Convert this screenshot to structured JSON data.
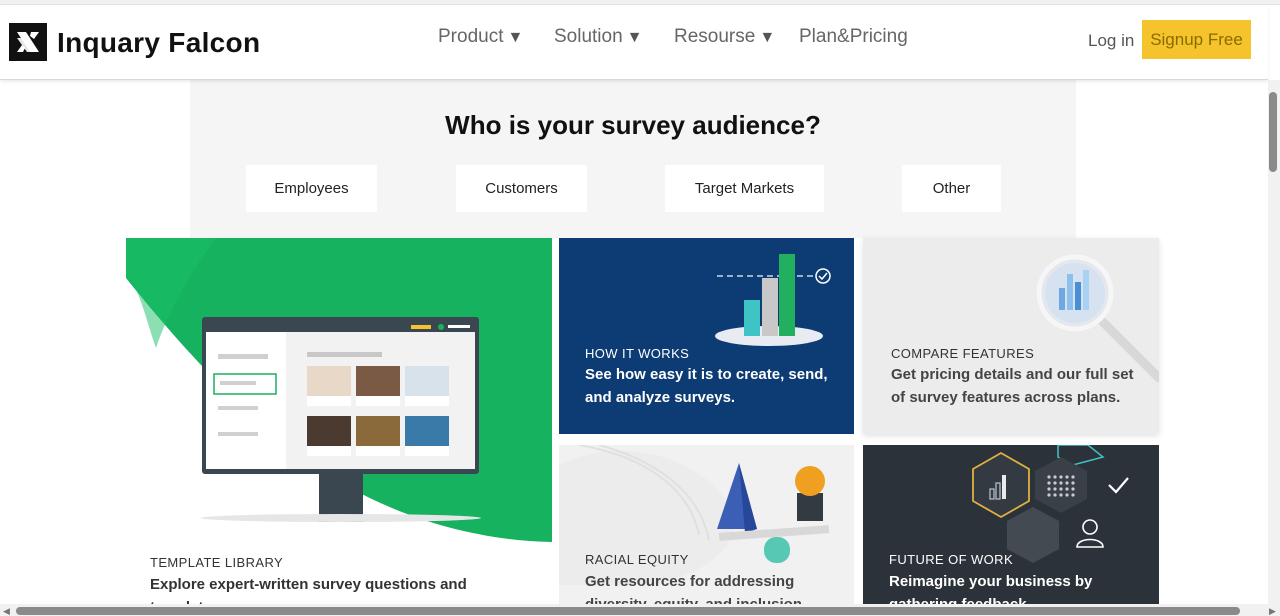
{
  "header": {
    "brand": "Inquary Falcon",
    "nav": [
      {
        "label": "Product",
        "caret": "▼"
      },
      {
        "label": "Solution",
        "caret": "▼"
      },
      {
        "label": "Resourse",
        "caret": "▼"
      },
      {
        "label": "Plan&Pricing",
        "caret": ""
      }
    ],
    "login": "Log in",
    "signup": "Signup Free"
  },
  "audience": {
    "title": "Who is your survey audience?",
    "options": [
      "Employees",
      "Customers",
      "Target Markets",
      "Other"
    ]
  },
  "cards": {
    "template_library": {
      "label": "TEMPLATE LIBRARY",
      "text": "Explore expert-written survey questions and templates"
    },
    "how_it_works": {
      "label": "HOW IT WORKS",
      "text_1": "See how easy it is to create, send,",
      "text_2": "and analyze surveys."
    },
    "compare_features": {
      "label": "COMPARE FEATURES",
      "text_1": "Get pricing details and our full set",
      "text_2": "of survey features across plans."
    },
    "racial_equity": {
      "label": "RACIAL EQUITY",
      "text_1": "Get resources for addressing",
      "text_2": "diversity, equity, and inclusion"
    },
    "future_of_work": {
      "label": "FUTURE OF WORK",
      "text_1": "Reimagine your business by",
      "text_2": "gathering feedback"
    }
  },
  "colors": {
    "brand_yellow": "#f5c32c",
    "green": "#17b25f",
    "navy": "#0d3b73",
    "dark": "#2c3239"
  }
}
